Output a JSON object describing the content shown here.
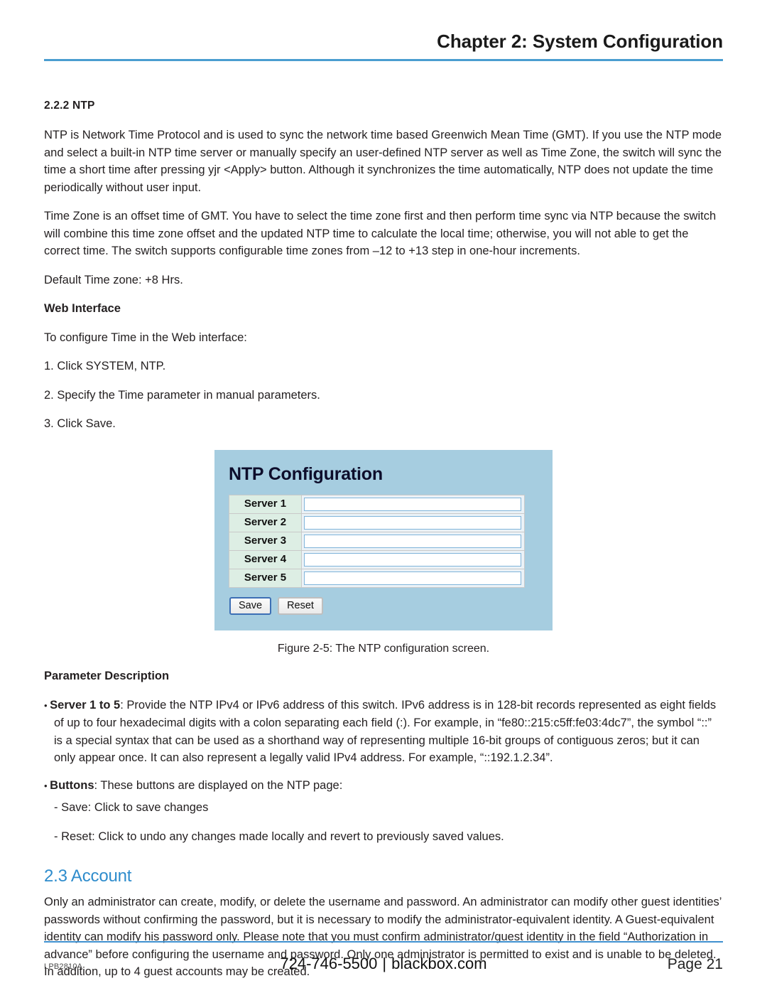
{
  "header": {
    "chapter_title": "Chapter 2: System Configuration",
    "rule_color": "#4a9dd0"
  },
  "section_ntp": {
    "heading": "2.2.2 NTP",
    "paragraph_1": "NTP is Network Time Protocol and is used to sync the network time based Greenwich Mean Time (GMT). If you use the NTP mode and select a built-in NTP time server or manually specify an user-defined NTP server as well as Time Zone, the switch will sync the time a short time after pressing yjr <Apply> button. Although it synchronizes the time automatically, NTP does not update the time periodically without user input.",
    "paragraph_2": "Time Zone is an offset time of GMT. You have to select the time zone first and then perform time sync via NTP because the switch will combine this time zone offset and the updated NTP time to calculate the local time; otherwise, you will not able to get the correct time. The switch supports configurable time zones from –12 to +13 step in one-hour increments.",
    "default_time_zone": "Default Time zone: +8 Hrs.",
    "web_interface_heading": "Web Interface",
    "web_interface_intro": "To configure Time in the Web interface:",
    "steps": [
      "1. Click SYSTEM, NTP.",
      "2. Specify the Time parameter in manual parameters.",
      "3. Click Save."
    ]
  },
  "figure": {
    "caption": "Figure 2-5: The NTP configuration screen.",
    "panel": {
      "title": "NTP Configuration",
      "background_color": "#a6cde0",
      "label_cell_color": "#ddeee4",
      "rows": [
        {
          "label": "Server 1",
          "value": "",
          "placeholder": ""
        },
        {
          "label": "Server 2",
          "value": "",
          "placeholder": ""
        },
        {
          "label": "Server 3",
          "value": "",
          "placeholder": ""
        },
        {
          "label": "Server 4",
          "value": "",
          "placeholder": ""
        },
        {
          "label": "Server 5",
          "value": "",
          "placeholder": ""
        }
      ],
      "buttons": {
        "save_label": "Save",
        "reset_label": "Reset",
        "save_focus_color": "#3d6fb5"
      }
    }
  },
  "parameter_description": {
    "heading": "Parameter Description",
    "bullets": [
      {
        "bold_lead": "Server 1 to 5",
        "text": ": Provide the NTP IPv4 or IPv6 address of this switch. IPv6 address is in 128-bit records represented as eight fields of up to four hexadecimal digits with a colon separating each field (:). For example, in “fe80::215:c5ff:fe03:4dc7”, the symbol “::” is a special syntax that can be used as a shorthand way of representing multiple 16-bit groups of contiguous zeros; but it can only appear once. It can also represent a legally valid IPv4 address. For example, “::192.1.2.34”."
      },
      {
        "bold_lead": "Buttons",
        "text": ": These buttons are displayed on the NTP page:"
      }
    ],
    "sub_items": [
      "- Save: Click to save changes",
      "- Reset: Click to undo any changes made locally and revert to previously saved values."
    ]
  },
  "section_account": {
    "heading": "2.3 Account",
    "heading_color": "#2e8ccc",
    "paragraph": "Only an administrator can create, modify, or delete the username and password. An administrator can modify other guest identities’ passwords without confirming the password, but it is necessary to modify the administrator-equivalent identity. A Guest-equivalent identity can modify his password only. Please note that you must confirm administrator/guest identity in the field “Authorization in advance” before configuring the username and password. Only one administrator is permitted to exist and is unable to be deleted. In addition, up to 4 guest accounts may be created."
  },
  "footer": {
    "model": "LPB2810A",
    "phone": "724-746-5500",
    "separator": "|",
    "site": "blackbox.com",
    "page": "Page 21",
    "rule_color": "#3f90cf"
  }
}
